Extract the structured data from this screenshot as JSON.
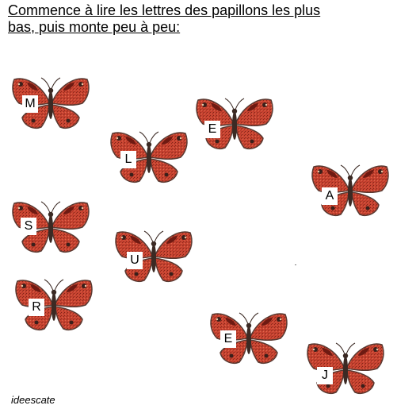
{
  "instruction": {
    "line1": "Commence à lire les lettres des papillons les plus",
    "line2": "bas, puis monte peu à peu:"
  },
  "butterflies": [
    {
      "letter": "M"
    },
    {
      "letter": "E"
    },
    {
      "letter": "L"
    },
    {
      "letter": "A"
    },
    {
      "letter": "S"
    },
    {
      "letter": "U"
    },
    {
      "letter": "R"
    },
    {
      "letter": "E"
    },
    {
      "letter": "J"
    }
  ],
  "credit": "ideescate",
  "colors": {
    "wing": "#c8402e",
    "wing_dark": "#7a1c14",
    "wing_edge": "#5a3a32",
    "body": "#3b2a24",
    "spot": "#e8c9a8"
  }
}
